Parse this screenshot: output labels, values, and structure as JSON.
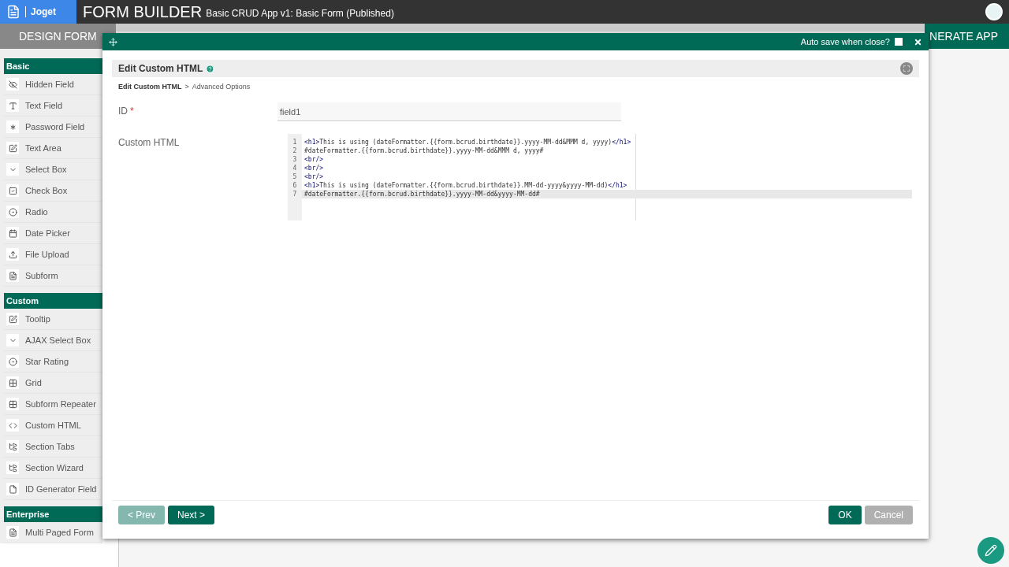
{
  "header": {
    "brand": "Joget",
    "title": "FORM BUILDER",
    "subtitle": "Basic CRUD App v1: Basic Form (Published)"
  },
  "tabs": [
    {
      "label": "DESIGN FORM",
      "selected": true
    },
    {
      "label": "NERATE APP",
      "selected": false
    }
  ],
  "palette": [
    {
      "heading": "Basic",
      "items": [
        "Hidden Field",
        "Text Field",
        "Password Field",
        "Text Area",
        "Select Box",
        "Check Box",
        "Radio",
        "Date Picker",
        "File Upload",
        "Subform"
      ]
    },
    {
      "heading": "Custom",
      "items": [
        "Tooltip",
        "AJAX Select Box",
        "Star Rating",
        "Grid",
        "Subform Repeater",
        "Custom HTML",
        "Section Tabs",
        "Section Wizard",
        "ID Generator Field"
      ]
    },
    {
      "heading": "Enterprise",
      "items": [
        "Multi Paged Form"
      ]
    }
  ],
  "dialog": {
    "autosave_label": "Auto save when close?",
    "autosave_checked": false,
    "title": "Edit Custom HTML",
    "breadcrumb": [
      {
        "label": "Edit Custom HTML",
        "selected": true
      },
      {
        "label": "Advanced Options",
        "selected": false
      }
    ],
    "breadcrumb_separator": ">",
    "fields": [
      {
        "label": "ID",
        "required_mark": "*",
        "kind": "text",
        "value": "field1"
      },
      {
        "label": "Custom HTML",
        "kind": "code",
        "lines": [
          {
            "active": false,
            "segments": [
              {
                "kind": "tag",
                "text": "<h1>"
              },
              {
                "kind": "text",
                "text": "This is using (dateFormatter.{{form.bcrud.birthdate}}.yyyy-MM-dd&MMM d, yyyy)"
              },
              {
                "kind": "tag",
                "text": "</h1>"
              }
            ]
          },
          {
            "active": false,
            "segments": [
              {
                "kind": "text",
                "text": "#dateFormatter.{{form.bcrud.birthdate}}.yyyy-MM-dd&MMM d, yyyy#"
              }
            ]
          },
          {
            "active": false,
            "segments": [
              {
                "kind": "tag",
                "text": "<br/>"
              }
            ]
          },
          {
            "active": false,
            "segments": [
              {
                "kind": "tag",
                "text": "<br/>"
              }
            ]
          },
          {
            "active": false,
            "segments": [
              {
                "kind": "tag",
                "text": "<br/>"
              }
            ]
          },
          {
            "active": false,
            "segments": [
              {
                "kind": "tag",
                "text": "<h1>"
              },
              {
                "kind": "text",
                "text": "This is using (dateFormatter.{{form.bcrud.birthdate}}.MM-dd-yyyy&yyyy-MM-dd)"
              },
              {
                "kind": "tag",
                "text": "</h1>"
              }
            ]
          },
          {
            "active": true,
            "segments": [
              {
                "kind": "text",
                "text": "#dateFormatter.{{form.bcrud.birthdate}}.yyyy-MM-dd&yyyy-MM-dd#"
              }
            ]
          }
        ],
        "line_numbers": [
          "1",
          "2",
          "3",
          "4",
          "5",
          "6",
          "7"
        ]
      }
    ],
    "buttons": [
      {
        "label": "< Prev",
        "kind": "nav",
        "disabled": true
      },
      {
        "label": "Next >",
        "kind": "nav",
        "disabled": false
      },
      {
        "label": "OK",
        "kind": "primary",
        "disabled": false
      },
      {
        "label": "Cancel",
        "kind": "secondary",
        "disabled": true
      }
    ]
  }
}
